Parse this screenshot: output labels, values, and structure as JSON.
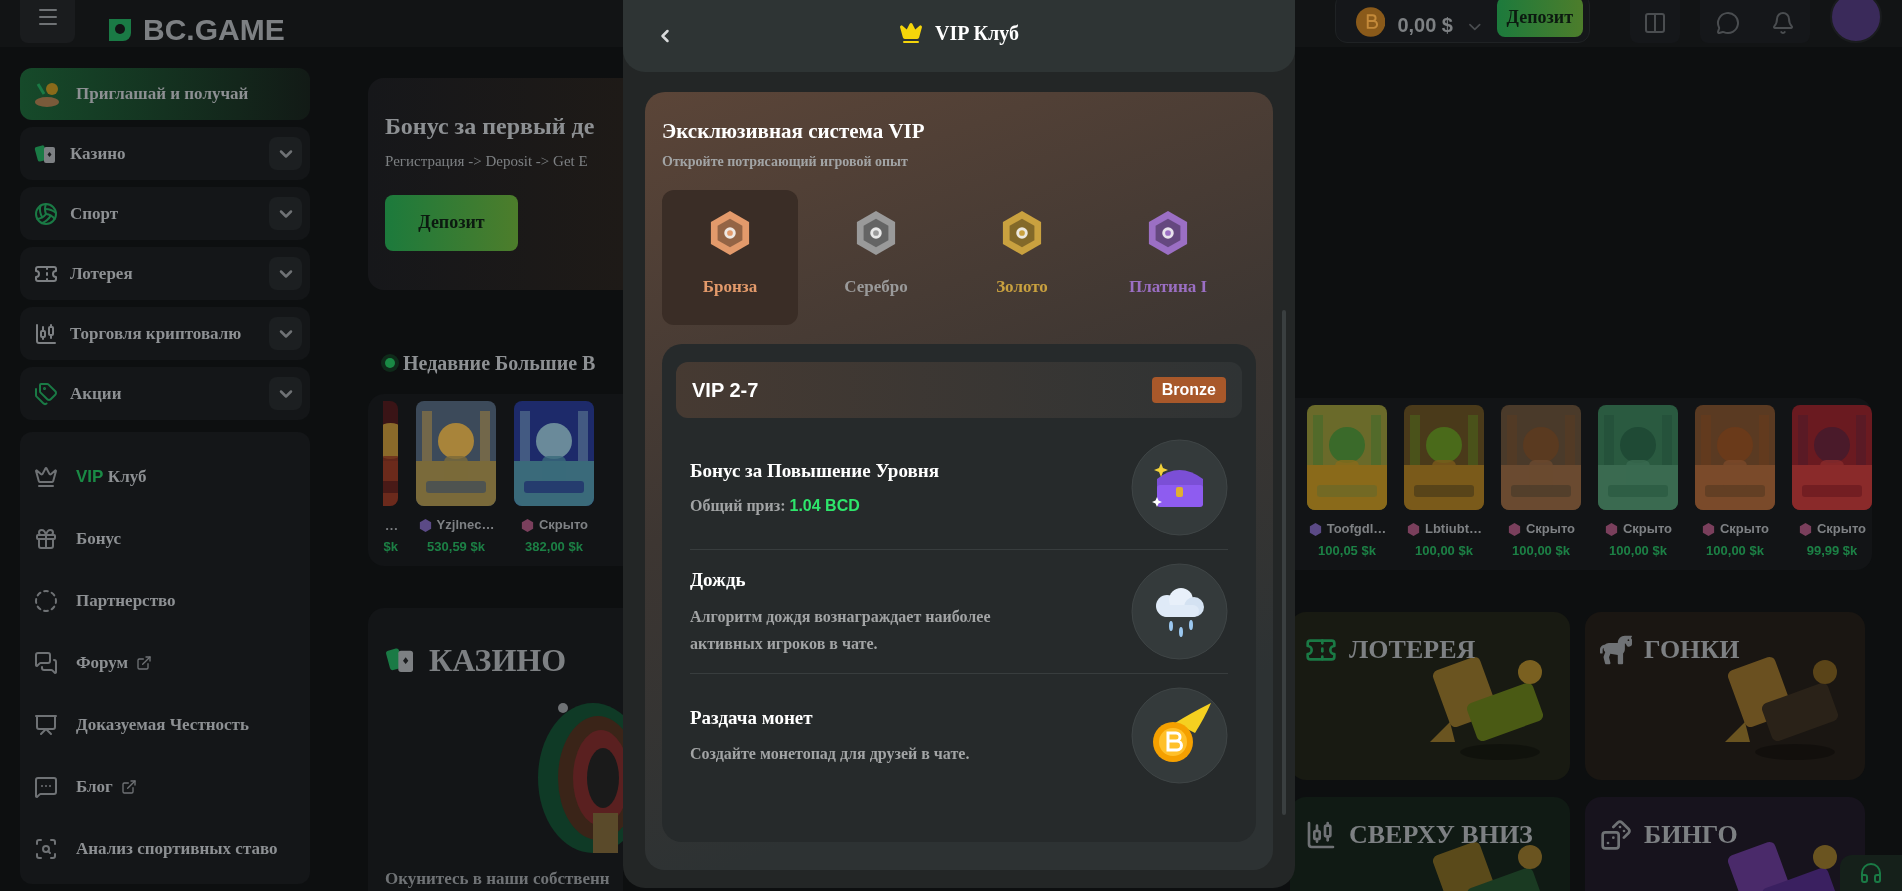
{
  "header": {
    "logo": "BC.GAME",
    "balance": "0,00 $",
    "deposit": "Депозит"
  },
  "sidebar": {
    "invite": "Приглашай и получай",
    "categories": [
      {
        "label": "Казино",
        "expanded": false
      },
      {
        "label": "Спорт",
        "expanded": false
      },
      {
        "label": "Лотерея",
        "expanded": false
      },
      {
        "label": "Торговля криптовалю",
        "expanded": false
      },
      {
        "label": "Акции",
        "expanded": false
      }
    ],
    "links": [
      {
        "accent": "VIP",
        "label": "Клуб",
        "external": false
      },
      {
        "label": "Бонус",
        "external": false
      },
      {
        "label": "Партнерство",
        "external": false
      },
      {
        "label": "Форум",
        "external": true
      },
      {
        "label": "Доказуемая Честность",
        "external": false
      },
      {
        "label": "Блог",
        "external": true
      },
      {
        "label": "Анализ спортивных ставо",
        "external": false
      }
    ]
  },
  "banner": {
    "title": "Бонус за первый де",
    "subtitle": "Регистрация -> Deposit -> Get E",
    "button": "Депозит"
  },
  "big_wins": {
    "title": "Недавние Большие В",
    "left_cards": [
      {
        "name": "…",
        "amount": "$k"
      },
      {
        "name": "Yzjlnec…",
        "amount": "530,59 $k",
        "color": "#5b4a86"
      },
      {
        "name": "Скрыто",
        "amount": "382,00 $k",
        "color": "#7a3f5c"
      }
    ],
    "right_cards": [
      {
        "name": "Toofgdl…",
        "amount": "100,05 $k",
        "color": "#5b4a86"
      },
      {
        "name": "Lbtiubt…",
        "amount": "100,00 $k",
        "color": "#7a3f5c"
      },
      {
        "name": "Скрыто",
        "amount": "100,00 $k",
        "color": "#7a3f5c"
      },
      {
        "name": "Скрыто",
        "amount": "100,00 $k",
        "color": "#7a3f5c"
      },
      {
        "name": "Скрыто",
        "amount": "100,00 $k",
        "color": "#7a3f5c"
      },
      {
        "name": "Скрыто",
        "amount": "99,99 $k",
        "color": "#7a3f5c"
      }
    ]
  },
  "casino": {
    "title": "КАЗИНО",
    "text": "Окунитесь в наши собственн"
  },
  "game_tiles": [
    {
      "title": "ЛОТЕРЕЯ"
    },
    {
      "title": "ГОНКИ"
    },
    {
      "title": "СВЕРХУ ВНИЗ"
    },
    {
      "title": "БИНГО"
    }
  ],
  "modal": {
    "title": "VIP Клуб",
    "heading": "Эксклюзивная система VIP",
    "subheading": "Откройте потрясающий игровой опыт",
    "tiers": [
      {
        "label": "Бронза",
        "selected": true,
        "color": "#e39a6b"
      },
      {
        "label": "Серебро",
        "selected": false,
        "color": "#9a9a9a"
      },
      {
        "label": "Золото",
        "selected": false,
        "color": "#c9a13f"
      },
      {
        "label": "Платина I",
        "selected": false,
        "color": "#9b6fc4"
      }
    ],
    "level": {
      "range": "VIP 2-7",
      "badge": "Bronze"
    },
    "features": [
      {
        "kind": "prize",
        "title": "Бонус за Повышение Уровня",
        "label": "Общий приз:",
        "value": "1.04 BCD"
      },
      {
        "kind": "text",
        "title": "Дождь",
        "text": "Алгоритм дождя вознаграждает наиболее активных игроков в чате."
      },
      {
        "kind": "text",
        "title": "Раздача монет",
        "text": "Создайте монетопад для друзей в чате."
      }
    ]
  }
}
